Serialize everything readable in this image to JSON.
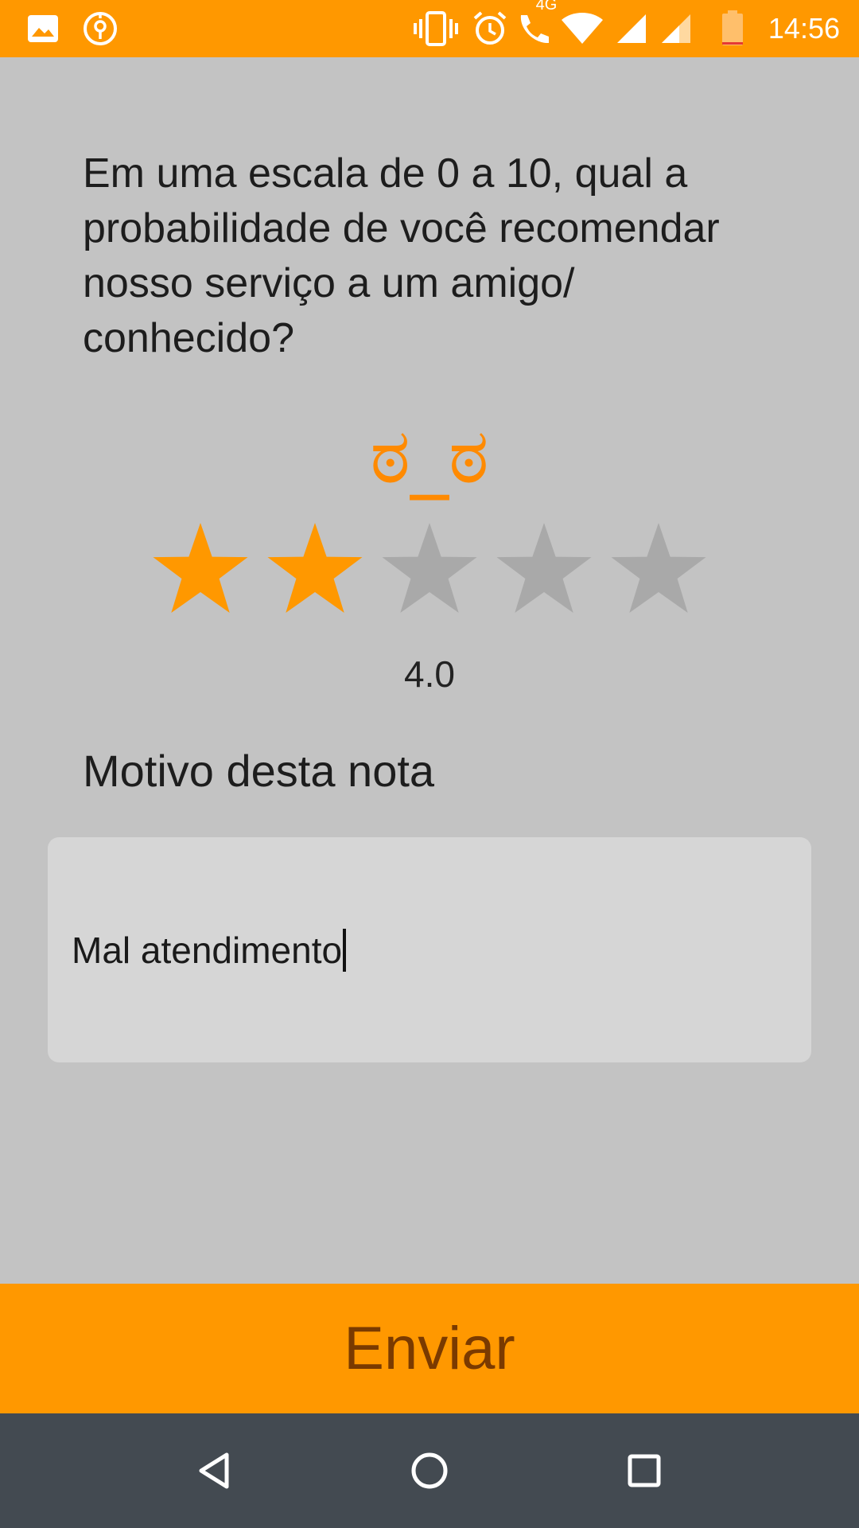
{
  "status_bar": {
    "time": "14:56",
    "network_label": "4G",
    "icons": [
      "gallery-icon",
      "location-icon",
      "vibrate-icon",
      "alarm-icon",
      "call-icon",
      "wifi-icon",
      "signal-icon",
      "signal-icon-2",
      "battery-icon"
    ],
    "battery_level": 0.1
  },
  "survey": {
    "question": "Em uma escala de 0 a 10, qual a probabilidade de você recomendar nosso serviço a um amigo/ conhecido?",
    "face": "ಠ_ಠ",
    "rating_value": 2,
    "rating_max": 5,
    "score_text": "4.0",
    "reason_label": "Motivo desta nota",
    "reason_value": "Mal atendimento"
  },
  "actions": {
    "send_label": "Enviar"
  },
  "colors": {
    "accent": "#ff9800",
    "star_filled": "#ff9800",
    "star_empty": "#a9a9a9",
    "background": "#c3c3c3"
  }
}
